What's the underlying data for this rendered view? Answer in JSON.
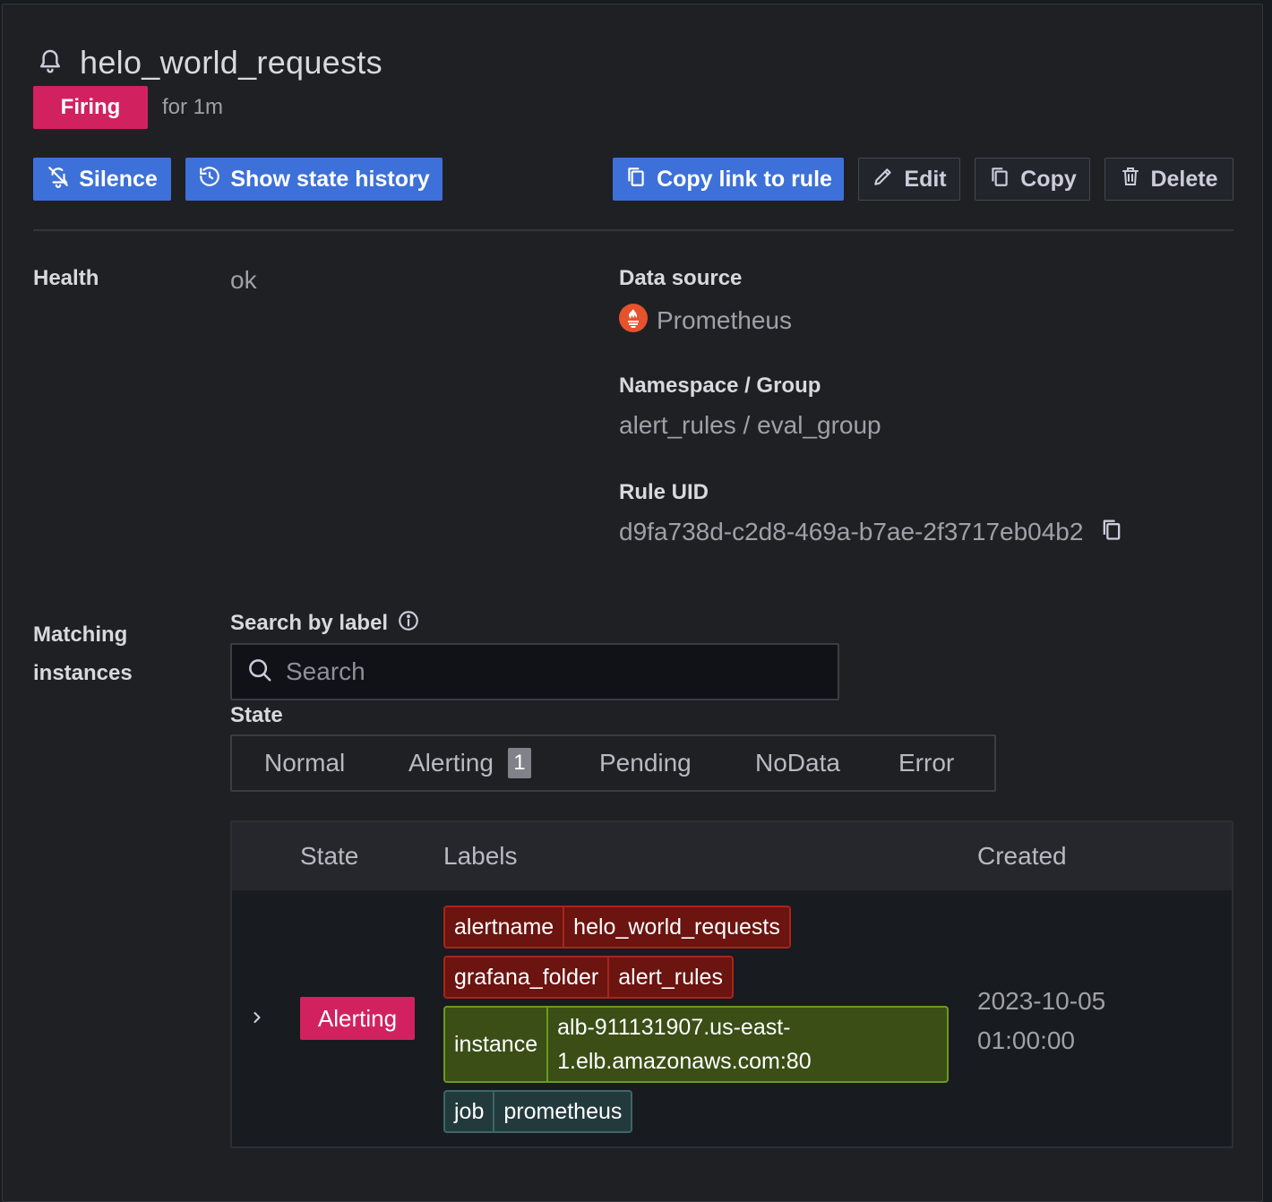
{
  "rule": {
    "title": "helo_world_requests",
    "state_badge": "Firing",
    "state_duration": "for 1m"
  },
  "actions": {
    "silence": "Silence",
    "show_state_history": "Show state history",
    "copy_link": "Copy link to rule",
    "edit": "Edit",
    "copy": "Copy",
    "delete": "Delete"
  },
  "details": {
    "health_label": "Health",
    "health_value": "ok",
    "datasource_label": "Data source",
    "datasource_value": "Prometheus",
    "namespace_label": "Namespace / Group",
    "namespace_value": "alert_rules / eval_group",
    "uid_label": "Rule UID",
    "uid_value": "d9fa738d-c2d8-469a-b7ae-2f3717eb04b2"
  },
  "instances": {
    "section_label_line1": "Matching",
    "section_label_line2": "instances",
    "search_label": "Search by label",
    "search_placeholder": "Search",
    "search_value": "",
    "state_label": "State",
    "state_filters": [
      {
        "label": "Normal"
      },
      {
        "label": "Alerting",
        "count": "1"
      },
      {
        "label": "Pending"
      },
      {
        "label": "NoData"
      },
      {
        "label": "Error"
      }
    ],
    "table": {
      "headers": {
        "state": "State",
        "labels": "Labels",
        "created": "Created"
      },
      "rows": [
        {
          "state": "Alerting",
          "labels": [
            {
              "key": "alertname",
              "value": "helo_world_requests",
              "color": "#6b1410"
            },
            {
              "key": "grafana_folder",
              "value": "alert_rules",
              "color": "#6b1410"
            },
            {
              "key": "instance",
              "value_line1": "alb-911131907.us-east-",
              "value_line2": "1.elb.amazonaws.com:80",
              "color": "#3a4e16"
            },
            {
              "key": "job",
              "value": "prometheus",
              "color": "#233a3c"
            }
          ],
          "created_date": "2023-10-05",
          "created_time": "01:00:00"
        }
      ]
    }
  },
  "colors": {
    "primary": "#3d71d9",
    "firing": "#d1225f",
    "background": "#1f2024"
  }
}
